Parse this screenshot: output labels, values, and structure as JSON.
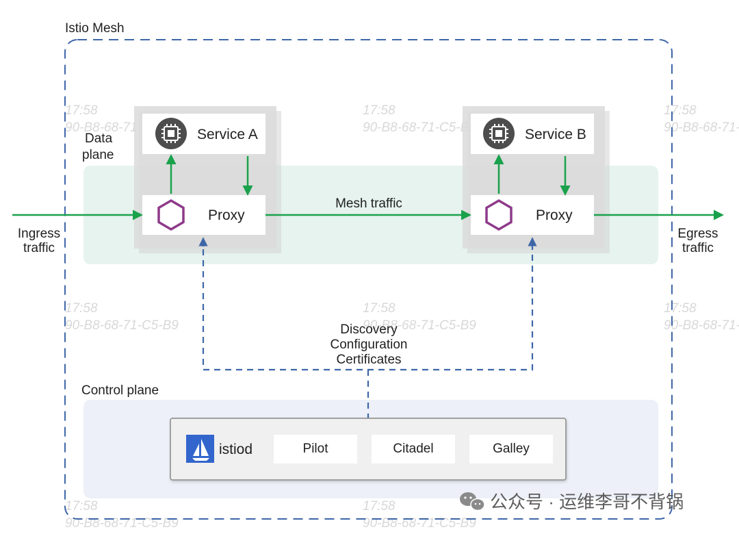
{
  "mesh": {
    "label": "Istio Mesh"
  },
  "data_plane": {
    "label_line1": "Data",
    "label_line2": "plane"
  },
  "control_plane": {
    "label": "Control plane"
  },
  "services": [
    {
      "name": "Service A",
      "proxy_label": "Proxy"
    },
    {
      "name": "Service B",
      "proxy_label": "Proxy"
    }
  ],
  "mesh_traffic_label": "Mesh traffic",
  "ingress": {
    "line1": "Ingress",
    "line2": "traffic"
  },
  "egress": {
    "line1": "Egress",
    "line2": "traffic"
  },
  "config_lines": [
    "Discovery",
    "Configuration",
    "Certificates"
  ],
  "istiod": {
    "label": "istiod",
    "components": [
      "Pilot",
      "Citadel",
      "Galley"
    ]
  },
  "footer": {
    "text": "公众号 · 运维李哥不背锅"
  },
  "watermarks": [
    {
      "time": "17:58",
      "id": "90-B8-68-71-C5-B9"
    }
  ],
  "colors": {
    "mesh_border": "#3d66a8",
    "data_plane_bg": "#e6f3ee",
    "control_plane_bg": "#edf0f8",
    "arrow_green": "#1aa14b",
    "dashed_blue": "#3d66a8",
    "hexagon": "#8e3a8a",
    "chip_icon": "#4d4d4d",
    "istiod_logo": "#3366cc"
  }
}
